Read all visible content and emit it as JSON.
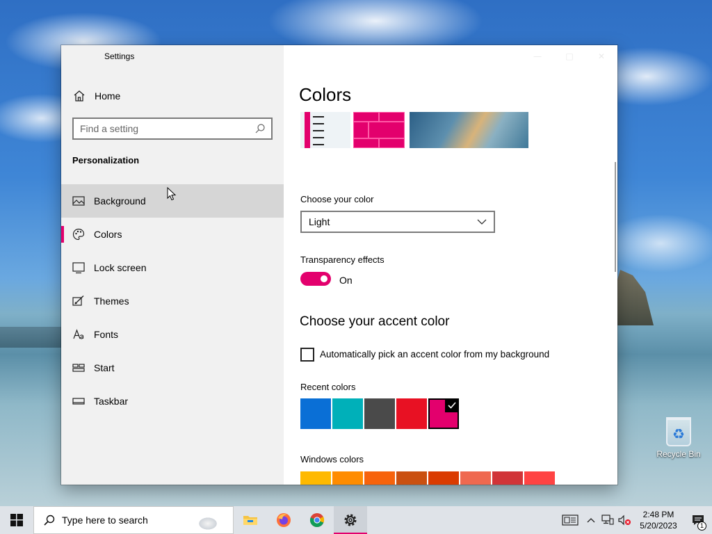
{
  "window": {
    "title": "Settings",
    "back_glyph": "←",
    "controls": {
      "minimize": "—",
      "maximize": "□",
      "close": "✕"
    }
  },
  "sidebar": {
    "home_label": "Home",
    "search_placeholder": "Find a setting",
    "section_title": "Personalization",
    "items": [
      {
        "label": "Background",
        "icon": "picture-icon",
        "state": "hover"
      },
      {
        "label": "Colors",
        "icon": "palette-icon",
        "state": "selected"
      },
      {
        "label": "Lock screen",
        "icon": "lock-screen-icon",
        "state": ""
      },
      {
        "label": "Themes",
        "icon": "brush-icon",
        "state": ""
      },
      {
        "label": "Fonts",
        "icon": "font-icon",
        "state": ""
      },
      {
        "label": "Start",
        "icon": "start-tiles-icon",
        "state": ""
      },
      {
        "label": "Taskbar",
        "icon": "taskbar-icon",
        "state": ""
      }
    ]
  },
  "content": {
    "title": "Colors",
    "choose_color_label": "Choose your color",
    "choose_color_value": "Light",
    "transparency_label": "Transparency effects",
    "transparency_state": "On",
    "accent_heading": "Choose your accent color",
    "auto_accent_label": "Automatically pick an accent color from my background",
    "auto_accent_checked": false,
    "recent_colors_label": "Recent colors",
    "recent_colors": [
      "#0a6fd6",
      "#00b0b9",
      "#4a4a4a",
      "#e81123",
      "#e3006d"
    ],
    "recent_selected_index": 4,
    "windows_colors_label": "Windows colors",
    "windows_colors": [
      "#ffb900",
      "#ff8c00",
      "#f7630c",
      "#ca5010",
      "#da3b01",
      "#ef6950",
      "#d13438",
      "#ff4343"
    ]
  },
  "colors": {
    "accent": "#e3006d",
    "sidebar_bg": "#f1f1f1",
    "taskbar_bg": "#dfe3e8"
  },
  "desktop": {
    "recycle_bin_label": "Recycle Bin"
  },
  "taskbar": {
    "search_text": "Type here to search",
    "apps": [
      "file-explorer-icon",
      "firefox-icon",
      "chrome-icon",
      "settings-gear-icon"
    ],
    "time": "2:48 PM",
    "date": "5/20/2023",
    "notification_count": "1"
  }
}
